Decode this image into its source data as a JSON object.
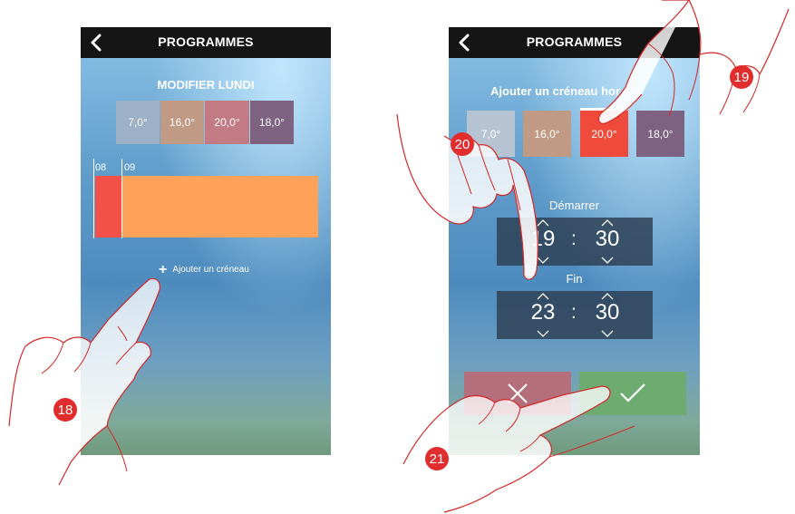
{
  "left_screen": {
    "title": "PROGRAMMES",
    "subtitle": "MODIFIER LUNDI",
    "temperatures": [
      {
        "label": "7,0°",
        "color": "#9cb0c7"
      },
      {
        "label": "16,0°",
        "color": "#c19a86"
      },
      {
        "label": "20,0°",
        "color": "#c27a85"
      },
      {
        "label": "18,0°",
        "color": "#7d6282"
      }
    ],
    "timeline": {
      "hours": [
        "08",
        "09"
      ],
      "segment_colors": [
        "#f15146",
        "#fea25a"
      ]
    },
    "add_slot_label": "Ajouter un créneau"
  },
  "right_screen": {
    "title": "PROGRAMMES",
    "subtitle": "Ajouter un créneau hor",
    "temperatures": [
      {
        "label": "7,0°",
        "color": "#b5c3d3"
      },
      {
        "label": "16,0°",
        "color": "#c19a86"
      },
      {
        "label": "20,0°",
        "color": "#f04a3c",
        "selected": true
      },
      {
        "label": "18,0°",
        "color": "#7d6282"
      }
    ],
    "start": {
      "label": "Démarrer",
      "hour": "19",
      "minute": "30"
    },
    "end": {
      "label": "Fin",
      "hour": "23",
      "minute": "30"
    },
    "cancel_color": "#b56f7c",
    "confirm_color": "#6dab71"
  },
  "steps": [
    "18",
    "19",
    "20",
    "21"
  ],
  "badge_color": "#e12d2d"
}
